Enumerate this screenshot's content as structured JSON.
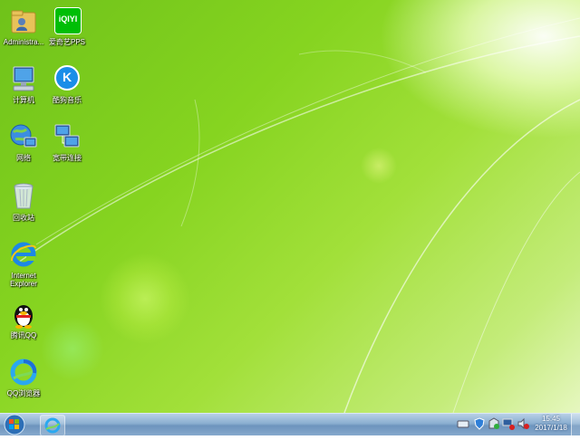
{
  "desktop_icons": [
    {
      "label": "Administra..."
    },
    {
      "label": "爱奇艺PPS"
    },
    {
      "label": "计算机"
    },
    {
      "label": "酷狗音乐"
    },
    {
      "label": "网络"
    },
    {
      "label": "宽带连接"
    },
    {
      "label": "回收站"
    },
    {
      "label": "Internet Explorer"
    },
    {
      "label": "腾讯QQ"
    },
    {
      "label": "QQ浏览器"
    }
  ],
  "app_icon_text": {
    "iqiyi": "iQIYI",
    "kugou": "K"
  },
  "taskbar": {
    "time": "15:45",
    "date": "2017/1/18"
  },
  "colors": {
    "wallpaper_green": "#86d420",
    "taskbar_blue": "#8aaed0",
    "iqiyi_green": "#00be06",
    "kugou_blue": "#1a8ee8"
  }
}
